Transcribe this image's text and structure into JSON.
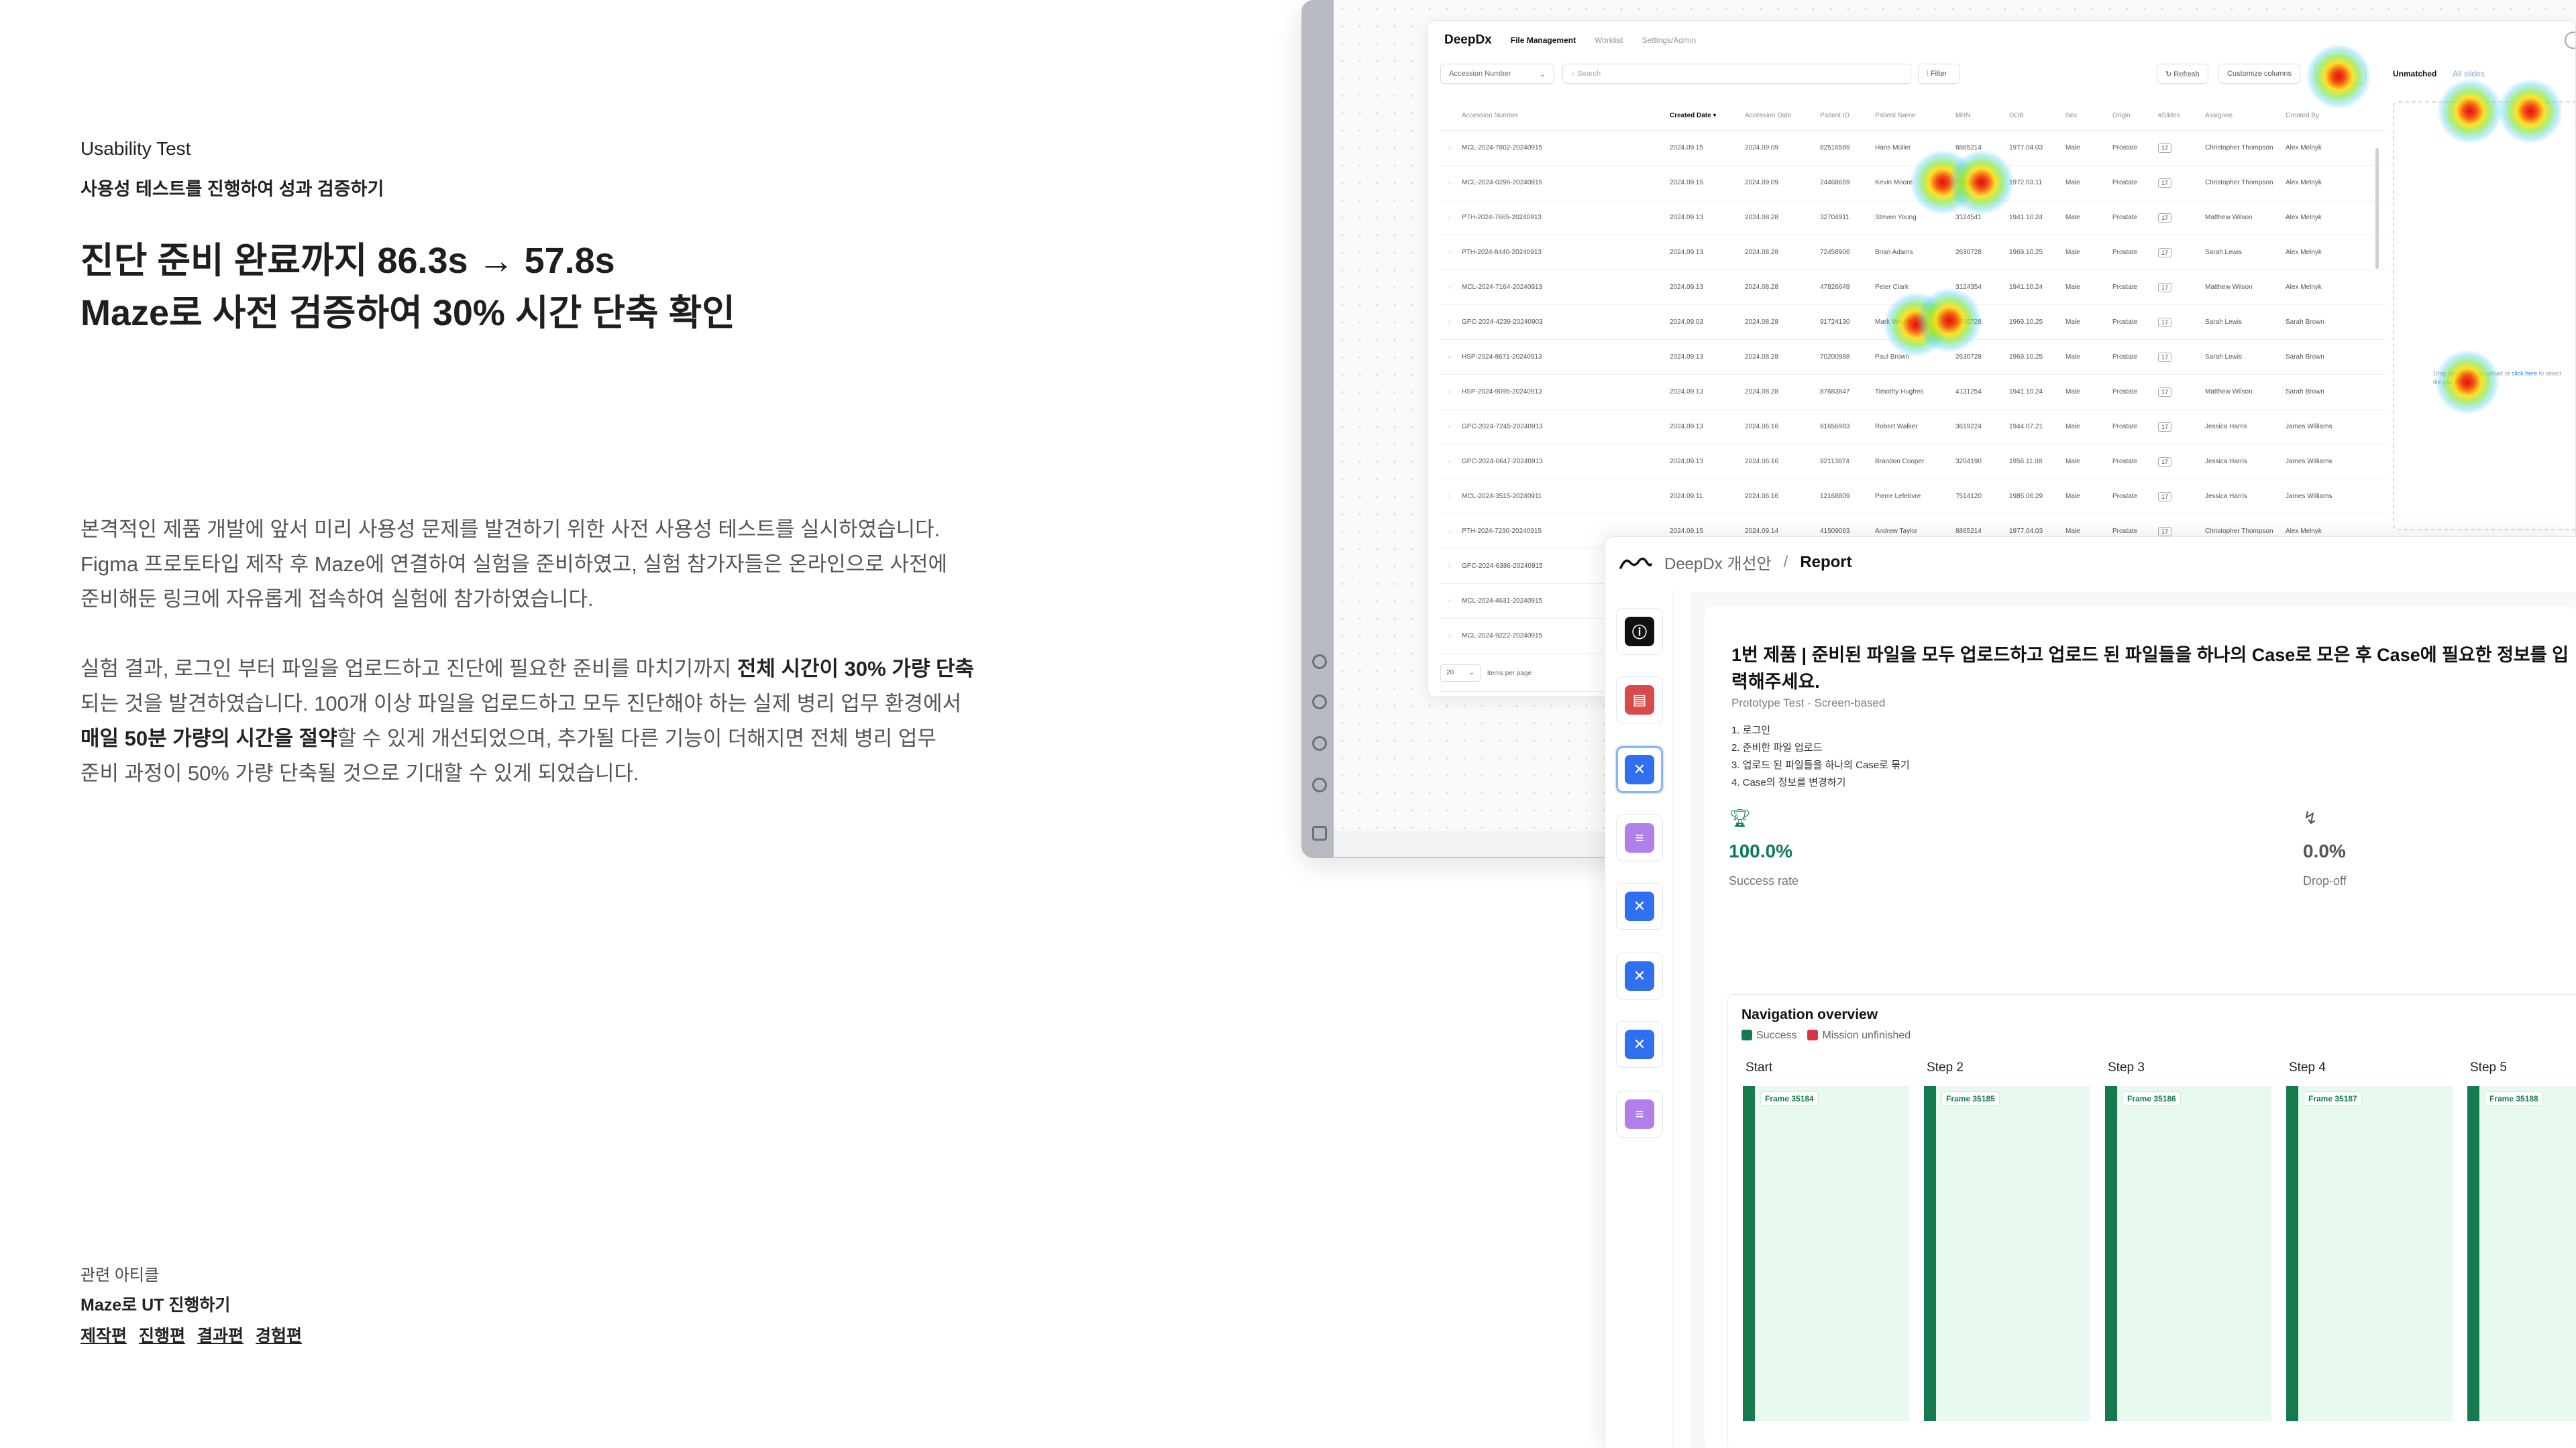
{
  "left": {
    "eyebrow": "Usability Test",
    "eyebrow_sub": "사용성 테스트를 진행하여 성과 검증하기",
    "headline_1": "진단 준비 완료까지 86.3s → 57.8s",
    "headline_2": "Maze로 사전 검증하여 30% 시간 단축 확인",
    "para1": [
      "본격적인 제품 개발에 앞서 미리 사용성 문제를 발견하기 위한 사전 사용성 테스트를 실시하였습니다.",
      "Figma 프로토타입 제작 후 Maze에 연결하여 실험을 준비하였고, 실험 참가자들은 온라인으로 사전에",
      "준비해둔 링크에 자유롭게 접속하여 실험에 참가하였습니다."
    ],
    "para2_a": "실험 결과, 로그인 부터 파일을 업로드하고 진단에 필요한 준비를 마치기까지 ",
    "para2_b": "전체 시간이 30% 가량 단축",
    "para2_c": "되는 것을 발견하였습니다. 100개 이상 파일을 업로드하고 모두 진단해야 하는 실제 병리 업무 환경에서",
    "para2_d": "매일 50분 가량의 시간을 절약",
    "para2_e": "할 수 있게 개선되었으며, 추가될 다른 기능이 더해지면 전체 병리 업무",
    "para2_f": "준비 과정이 50% 가량 단축될 것으로 기대할 수 있게 되었습니다.",
    "related_label": "관련 아티클",
    "related_title": "Maze로 UT 진행하기",
    "related_links": [
      "제작편",
      "진행편",
      "결과편",
      "경험편"
    ]
  },
  "app": {
    "logo": "DeepDx",
    "nav": [
      "File Management",
      "Worklist",
      "Settings/Admin"
    ],
    "select_label": "Accession Number",
    "search_placeholder": "Search",
    "filter_label": "Filter",
    "refresh_label": "Refresh",
    "customize_label": "Customize columns",
    "tab_unmatched": "Unmatched",
    "tab_all": "All slides",
    "columns": [
      "Accession Number",
      "Created Date",
      "Accession Date",
      "Patient ID",
      "Patient Name",
      "MRN",
      "DOB",
      "Sex",
      "Origin",
      "#Slides",
      "Assignee",
      "Created By"
    ],
    "rows": [
      [
        "MCL-2024-7802-20240915",
        "2024.09.15",
        "2024.09.09",
        "82516589",
        "Hans Müller",
        "8865214",
        "1977.04.03",
        "Male",
        "Prostate",
        "17",
        "Christopher Thompson",
        "Alex Melnyk"
      ],
      [
        "MCL-2024-0296-20240915",
        "2024.09.15",
        "2024.09.09",
        "24468659",
        "Kevin Moore",
        "7764521",
        "1972.03.11",
        "Male",
        "Prostate",
        "17",
        "Christopher Thompson",
        "Alex Melnyk"
      ],
      [
        "PTH-2024-7665-20240913",
        "2024.09.13",
        "2024.08.28",
        "32704911",
        "Steven Young",
        "3124541",
        "1941.10.24",
        "Male",
        "Prostate",
        "17",
        "Matthew Wilson",
        "Alex Melnyk"
      ],
      [
        "PTH-2024-8440-20240913",
        "2024.09.13",
        "2024.08.28",
        "72458906",
        "Brian Adams",
        "2630728",
        "1969.10.25",
        "Male",
        "Prostate",
        "17",
        "Sarah Lewis",
        "Alex Melnyk"
      ],
      [
        "MCL-2024-7164-20240913",
        "2024.09.13",
        "2024.08.28",
        "47826649",
        "Peter Clark",
        "3124354",
        "1941.10.24",
        "Male",
        "Prostate",
        "17",
        "Matthew Wilson",
        "Alex Melnyk"
      ],
      [
        "GPC-2024-4239-20240903",
        "2024.09.03",
        "2024.08.28",
        "91724130",
        "Mark Wright",
        "2630728",
        "1969.10.25",
        "Male",
        "Prostate",
        "17",
        "Sarah Lewis",
        "Sarah Brown"
      ],
      [
        "HSP-2024-8671-20240913",
        "2024.09.13",
        "2024.08.28",
        "70200988",
        "Paul Brown",
        "2630728",
        "1969.10.25",
        "Male",
        "Prostate",
        "17",
        "Sarah Lewis",
        "Sarah Brown"
      ],
      [
        "HSP-2024-9095-20240913",
        "2024.09.13",
        "2024.08.28",
        "87683847",
        "Timothy Hughes",
        "4131254",
        "1941.10.24",
        "Male",
        "Prostate",
        "17",
        "Matthew Wilson",
        "Sarah Brown"
      ],
      [
        "GPC-2024-7245-20240913",
        "2024.09.13",
        "2024.06.16",
        "91656983",
        "Robert Walker",
        "3619224",
        "1944.07.21",
        "Male",
        "Prostate",
        "17",
        "Jessica Harris",
        "James Williams"
      ],
      [
        "GPC-2024-0647-20240913",
        "2024.09.13",
        "2024.06.16",
        "92113874",
        "Brandon Cooper",
        "3204190",
        "1956.11.08",
        "Male",
        "Prostate",
        "17",
        "Jessica Harris",
        "James Williams"
      ],
      [
        "MCL-2024-3515-20240911",
        "2024.09.11",
        "2024.06.16",
        "12168809",
        "Pierre Lefebvre",
        "7514120",
        "1985.06.29",
        "Male",
        "Prostate",
        "17",
        "Jessica Harris",
        "James Williams"
      ],
      [
        "PTH-2024-7230-20240915",
        "2024.09.15",
        "2024.09.14",
        "41509063",
        "Andrew Taylor",
        "8865214",
        "1977.04.03",
        "Male",
        "Prostate",
        "17",
        "Christopher Thompson",
        "Alex Melnyk"
      ],
      [
        "GPC-2024-6386-20240915",
        "",
        "",
        "",
        "",
        "",
        "",
        "",
        "",
        "",
        "",
        ""
      ],
      [
        "MCL-2024-4631-20240915",
        "",
        "",
        "",
        "",
        "",
        "",
        "",
        "",
        "",
        "",
        ""
      ],
      [
        "MCL-2024-9222-20240915",
        "",
        "",
        "",
        "",
        "",
        "",
        "",
        "",
        "",
        "",
        ""
      ]
    ],
    "drop_text": "Drop your folder to upload or",
    "drop_link": "click here",
    "drop_text2": "to select file you add.",
    "page_size": "20",
    "page_size_label": "items per page"
  },
  "report": {
    "crumb": "DeepDx 개선안",
    "current": "Report",
    "question": "1번 제품 | 준비된 파일을 모두 업로드하고 업로드 된 파일들을 하나의 Case로 모은 후 Case에 필요한 정보를 입력해주세요.",
    "subtitle": "Prototype Test · Screen-based",
    "steps": [
      "1. 로그인",
      "2. 준비한 파일 업로드",
      "3. 업로드 된 파일들을 하나의 Case로 묶기",
      "4. Case의 정보를 변경하기"
    ],
    "success_value": "100.0%",
    "success_label": "Success rate",
    "dropoff_value": "0.0%",
    "dropoff_label": "Drop-off",
    "nav_title": "Navigation overview",
    "legend_success": "Success",
    "legend_unfinished": "Mission unfinished",
    "steps_overview": [
      {
        "label": "Start",
        "frame": "Frame 35184"
      },
      {
        "label": "Step 2",
        "frame": "Frame 35185"
      },
      {
        "label": "Step 3",
        "frame": "Frame 35186"
      },
      {
        "label": "Step 4",
        "frame": "Frame 35187"
      },
      {
        "label": "Step 5",
        "frame": "Frame 35188"
      }
    ],
    "colors": {
      "success": "#157a4e",
      "unfinished": "#d9344a",
      "heat": "#e60000"
    }
  }
}
